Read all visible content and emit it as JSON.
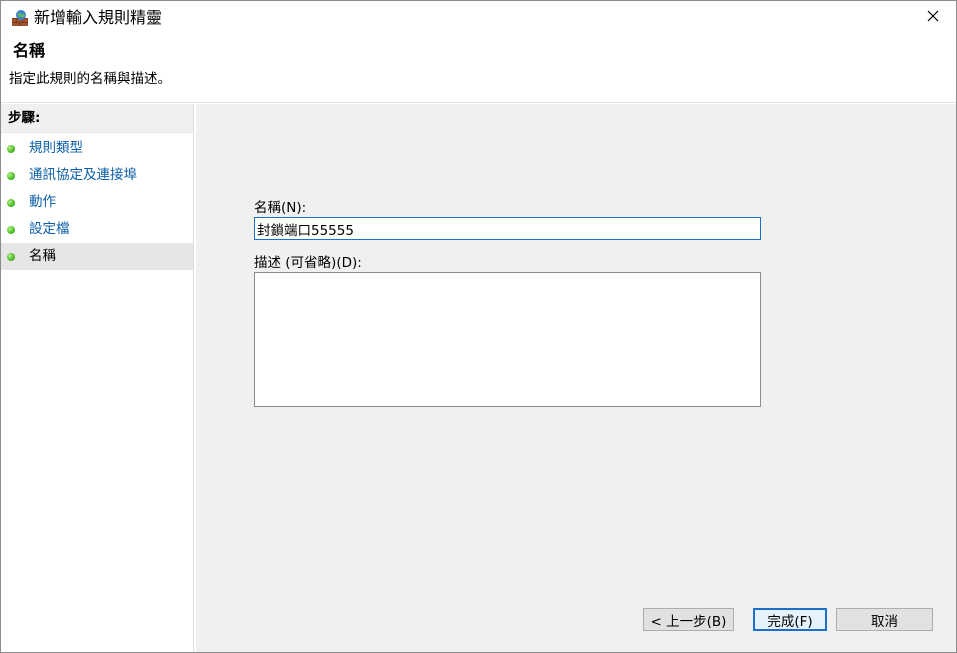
{
  "window": {
    "title": "新增輸入規則精靈",
    "app_icon": "firewall-icon",
    "close_icon": "close-icon"
  },
  "header": {
    "title": "名稱",
    "description": "指定此規則的名稱與描述。"
  },
  "steps": {
    "heading": "步驟:",
    "items": [
      {
        "label": "規則類型",
        "state": "link"
      },
      {
        "label": "通訊協定及連接埠",
        "state": "link"
      },
      {
        "label": "動作",
        "state": "link"
      },
      {
        "label": "設定檔",
        "state": "link"
      },
      {
        "label": "名稱",
        "state": "current"
      }
    ]
  },
  "form": {
    "name_label": "名稱(N):",
    "name_value": "封鎖端口55555",
    "desc_label": "描述 (可省略)(D):",
    "desc_value": ""
  },
  "buttons": {
    "back": "< 上一步(B)",
    "finish": "完成(F)",
    "cancel": "取消"
  },
  "colors": {
    "link": "#0b5fa8",
    "focus_border": "#1c6fc9",
    "content_bg": "#f0f0f0"
  }
}
